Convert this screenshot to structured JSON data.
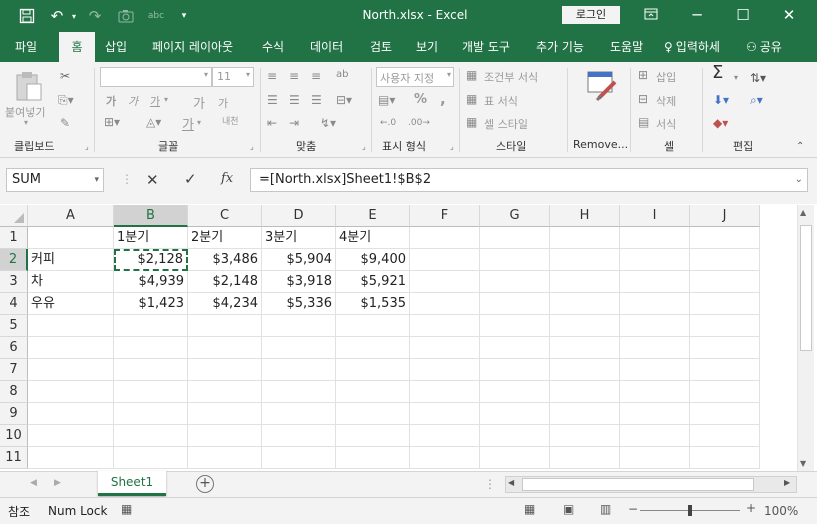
{
  "window": {
    "title": "North.xlsx  -  Excel",
    "login_label": "로그인"
  },
  "ribbon_tabs": [
    "파일",
    "홈",
    "삽입",
    "페이지 레이아웃",
    "수식",
    "데이터",
    "검토",
    "보기",
    "개발 도구",
    "추가 기능",
    "도움말",
    "입력하세",
    "공유"
  ],
  "ribbon": {
    "clipboard": {
      "paste_label": "붙여넣기",
      "group_label": "클립보드"
    },
    "font": {
      "font_size": "11",
      "bold": "가",
      "italic": "가",
      "underline": "가",
      "grow": "가",
      "shrink": "가",
      "font_color": "가",
      "phonetic": "내천",
      "group_label": "글꼴"
    },
    "alignment": {
      "group_label": "맞춤"
    },
    "number": {
      "format": "사용자 지정",
      "percent": "%",
      "comma": ",",
      "group_label": "표시 형식"
    },
    "styles": {
      "conditional": "조건부 서식",
      "table": "표 서식",
      "cell_style": "셀 스타일",
      "group_label": "스타일"
    },
    "addin": {
      "label": "Remove..."
    },
    "cells": {
      "insert": "삽입",
      "delete": "삭제",
      "format": "서식",
      "group_label": "셀"
    },
    "editing": {
      "sum_icon": "Σ",
      "group_label": "편집"
    }
  },
  "formula_bar": {
    "name_box": "SUM",
    "fx": "fx",
    "formula": "=[North.xlsx]Sheet1!$B$2"
  },
  "columns": [
    "A",
    "B",
    "C",
    "D",
    "E",
    "F",
    "G",
    "H",
    "I",
    "J"
  ],
  "rows": [
    "1",
    "2",
    "3",
    "4",
    "5",
    "6",
    "7",
    "8",
    "9",
    "10",
    "11"
  ],
  "cells": {
    "B1": "1분기",
    "C1": "2분기",
    "D1": "3분기",
    "E1": "4분기",
    "A2": "커피",
    "B2": "$2,128",
    "C2": "$3,486",
    "D2": "$5,904",
    "E2": "$9,400",
    "A3": "차",
    "B3": "$4,939",
    "C3": "$2,148",
    "D3": "$3,918",
    "E3": "$5,921",
    "A4": "우유",
    "B4": "$1,423",
    "C4": "$4,234",
    "D4": "$5,336",
    "E4": "$1,535"
  },
  "sheet_tabs": [
    "Sheet1"
  ],
  "status": {
    "mode": "참조",
    "num_lock": "Num Lock",
    "zoom": "100%"
  }
}
